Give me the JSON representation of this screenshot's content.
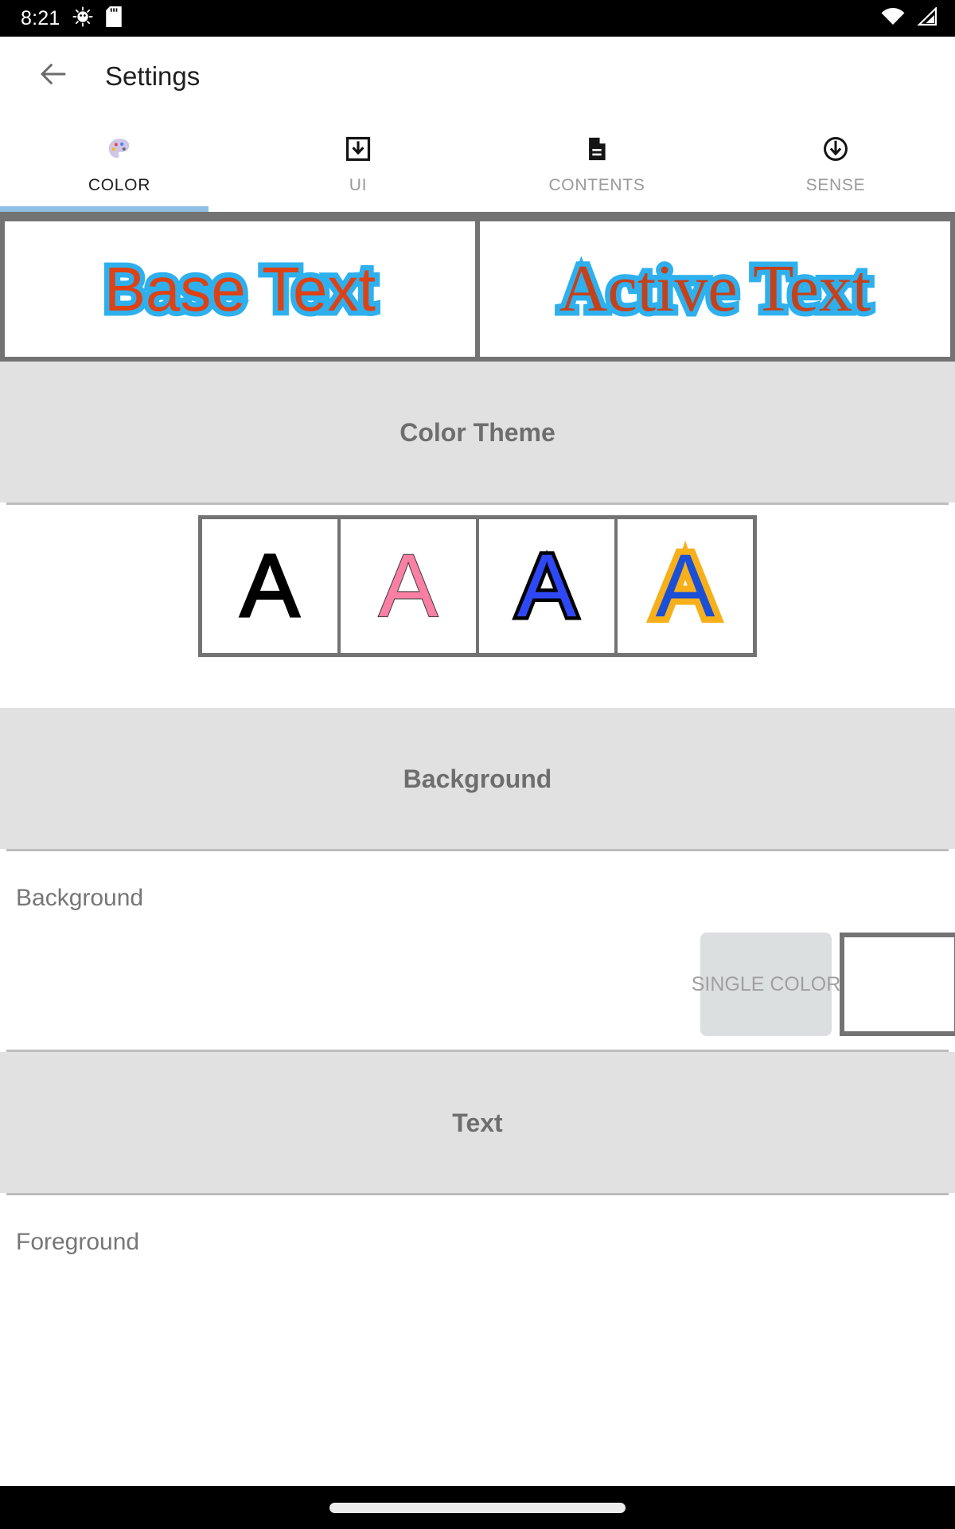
{
  "status_bar": {
    "time": "8:21",
    "icons_left": [
      "android-debug-icon",
      "sd-card-icon"
    ],
    "icons_right": [
      "wifi-icon",
      "cellular-signal-icon"
    ],
    "background_color": "#000000"
  },
  "app_bar": {
    "back_icon": "back-arrow-icon",
    "title": "Settings"
  },
  "tabs": {
    "active_index": 0,
    "indicator_color": "#90bfe4",
    "items": [
      {
        "label": "COLOR",
        "icon": "palette-icon",
        "active": true
      },
      {
        "label": "UI",
        "icon": "import-box-icon",
        "active": false
      },
      {
        "label": "CONTENTS",
        "icon": "document-icon",
        "active": false
      },
      {
        "label": "SENSE",
        "icon": "circle-down-arrow-icon",
        "active": false
      }
    ]
  },
  "preview": {
    "base": {
      "text": "Base Text",
      "fill_color": "#dd4215",
      "outline_color": "#2eb0ee"
    },
    "active": {
      "text": "Active Text",
      "fill_color": "#c4421b",
      "outline_color": "#2eb0ee"
    }
  },
  "sections": {
    "color_theme": {
      "title": "Color Theme",
      "swatches": [
        {
          "letter": "A",
          "fill": "#000000",
          "outline": "#000000"
        },
        {
          "letter": "A",
          "fill": "#fa7fa4",
          "outline": "#3a3a3a"
        },
        {
          "letter": "A",
          "fill": "#2f48f5",
          "outline": "#000000"
        },
        {
          "letter": "A",
          "fill": "#1a4fd6",
          "outline": "#f7b01a"
        }
      ]
    },
    "background": {
      "title": "Background",
      "row_label": "Background",
      "mode_label": "SINGLE COLOR",
      "color_value": "#ffffff"
    },
    "text": {
      "title": "Text",
      "row_label": "Foreground"
    }
  },
  "nav_bar": {
    "gesture_pill": "home-indicator"
  }
}
